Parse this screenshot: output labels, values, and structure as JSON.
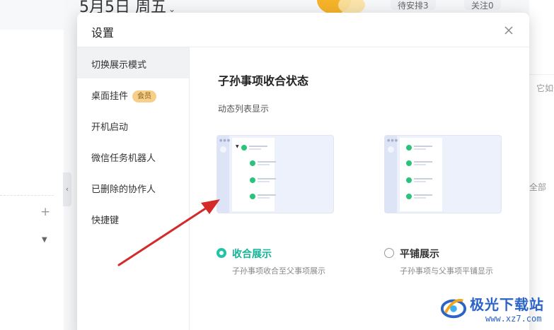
{
  "background": {
    "date_label": "5月5日 周五",
    "tab_pending": "待安排3",
    "tab_follow": "关注0",
    "right_text_top": "它如也",
    "right_text_all": "全部"
  },
  "dialog": {
    "title": "设置",
    "close_icon": "close-icon",
    "nav": [
      {
        "label": "切换展示模式",
        "active": true
      },
      {
        "label": "桌面挂件",
        "badge": "会员"
      },
      {
        "label": "开机启动"
      },
      {
        "label": "微信任务机器人"
      },
      {
        "label": "已删除的协作人"
      },
      {
        "label": "快捷键"
      }
    ],
    "section_title": "子孙事项收合状态",
    "section_subtitle": "动态列表显示",
    "options": [
      {
        "label": "收合展示",
        "description": "子孙事项收合至父事项展示",
        "selected": true
      },
      {
        "label": "平铺展示",
        "description": "子孙事项与父事项平铺显示",
        "selected": false
      }
    ]
  },
  "watermark": {
    "name": "极光下载站",
    "url": "www.xz7.com"
  },
  "colors": {
    "accent": "#14b497",
    "annotation_arrow": "#d42a2a",
    "badge_bg": "#f6d08a",
    "watermark_blue": "#2b63c7"
  }
}
